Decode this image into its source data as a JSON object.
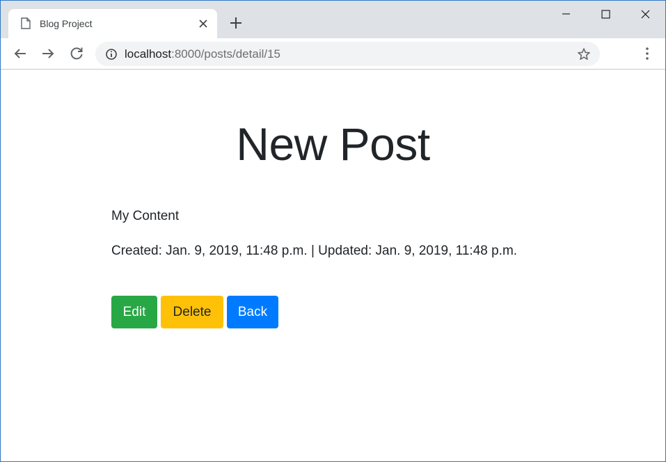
{
  "browser": {
    "tab": {
      "title": "Blog Project",
      "icon": "page-icon"
    },
    "window_controls": [
      "minimize-icon",
      "maximize-icon",
      "close-icon"
    ],
    "toolbar": {
      "url_host": "localhost",
      "url_rest": ":8000/posts/detail/15"
    }
  },
  "page": {
    "title": "New Post",
    "content": "My Content",
    "meta": "Created: Jan. 9, 2019, 11:48 p.m. | Updated: Jan. 9, 2019, 11:48 p.m.",
    "buttons": {
      "edit": "Edit",
      "delete": "Delete",
      "back": "Back"
    }
  },
  "colors": {
    "edit": "#28a745",
    "delete": "#ffc107",
    "back": "#007bff",
    "window_border": "#2b78c5"
  }
}
